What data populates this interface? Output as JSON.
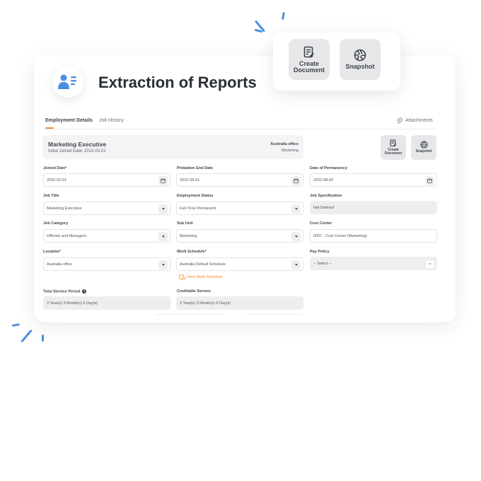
{
  "colors": {
    "accent": "#f28b30",
    "brand_blue": "#4a90e2",
    "button_grey": "#e7e7e9",
    "text_dark": "#3d4450"
  },
  "header": {
    "title": "Extraction of Reports",
    "icon": "user-profile-icon"
  },
  "floating_actions": {
    "create_document": {
      "label": "Create\nDocument",
      "icon": "document-edit-icon"
    },
    "snapshot": {
      "label": "Snapshot",
      "icon": "camera-aperture-icon"
    }
  },
  "tabs": [
    {
      "label": "Employment Details",
      "active": true
    },
    {
      "label": "Job History",
      "active": false
    }
  ],
  "attachments_label": "Attachments",
  "employment": {
    "job_title": "Marketing Executive",
    "initial_joined": "Initial Joined Date: 2022-02-01",
    "location": "Australia office",
    "department": "Marketing"
  },
  "small_actions": {
    "create_document": "Create\nDocument",
    "snapshot": "Snapshot"
  },
  "fields": {
    "joined_date": {
      "label": "Joined Date*",
      "value": "2022-02-01"
    },
    "probation_end": {
      "label": "Probation End Date",
      "value": "2022-08-01"
    },
    "permanency": {
      "label": "Date of Permanency",
      "value": "2022-08-02"
    },
    "job_title": {
      "label": "Job Title",
      "value": "Marketing Executive"
    },
    "employment_status": {
      "label": "Employment Status",
      "value": "Full-Time Permanent"
    },
    "job_spec": {
      "label": "Job Specification",
      "value": "Not Defined"
    },
    "job_category": {
      "label": "Job Category",
      "value": "Officials and Managers"
    },
    "sub_unit": {
      "label": "Sub Unit",
      "value": "Marketing"
    },
    "cost_center": {
      "label": "Cost Center",
      "value": "0007 - Cost Center (Marketing)"
    },
    "location": {
      "label": "Location*",
      "value": "Australia office"
    },
    "work_schedule": {
      "label": "Work Schedule*",
      "value": "Australia Default Schedule"
    },
    "pay_policy": {
      "label": "Pay Policy",
      "value": "-- Select --"
    },
    "total_service": {
      "label": "Total Service Period",
      "value": "3 Year(s) 3 Month(s) 6 Day(s)"
    },
    "creditable_service": {
      "label": "Creditable Service",
      "value": "3 Year(s) 3 Month(s) 6 Day(s)"
    }
  },
  "view_work_schedule": "View Work Schedule"
}
